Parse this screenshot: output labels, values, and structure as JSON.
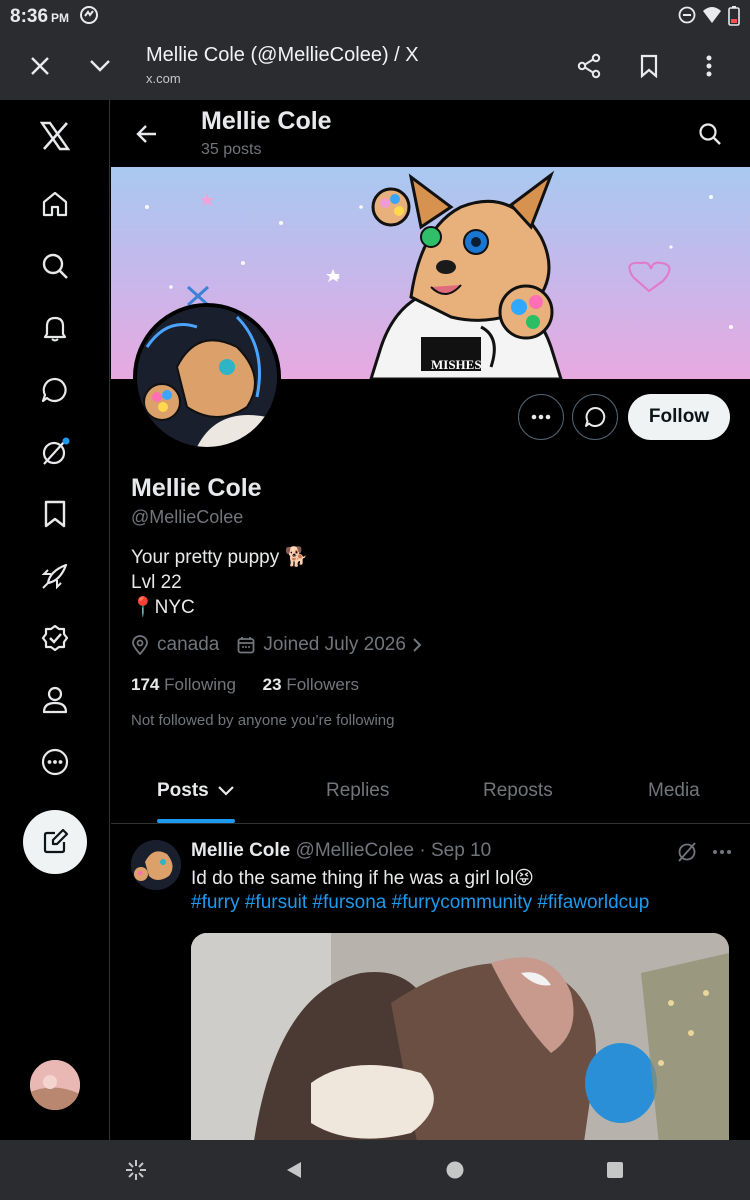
{
  "status_bar": {
    "time": "8:36",
    "ampm": "PM"
  },
  "browser": {
    "title": "Mellie Cole (@MellieColee) / X",
    "url": "x.com"
  },
  "header": {
    "name": "Mellie Cole",
    "post_count": "35 posts"
  },
  "profile": {
    "name": "Mellie Cole",
    "handle": "@MellieColee",
    "bio_lines": [
      "Your pretty puppy 🐕",
      "Lvl 22",
      "📍NYC"
    ],
    "location": "canada",
    "joined": "Joined July 2026",
    "following_count": "174",
    "following_label": "Following",
    "followers_count": "23",
    "followers_label": "Followers",
    "not_followed_text": "Not followed by anyone you’re following",
    "follow_label": "Follow"
  },
  "tabs": [
    {
      "label": "Posts",
      "active": true
    },
    {
      "label": "Replies",
      "active": false
    },
    {
      "label": "Reposts",
      "active": false
    },
    {
      "label": "Media",
      "active": false
    }
  ],
  "tweet": {
    "name": "Mellie Cole",
    "handle": "@MellieColee",
    "separator": "·",
    "date": "Sep 10",
    "text": "Id do the same thing if he was a girl lol😝",
    "hashtags": "#furry #fursuit #fursona #furrycommunity #fifaworldcup"
  },
  "banner_text": "MISHES",
  "colors": {
    "accent": "#1d9bf0",
    "background": "#000000",
    "muted": "#71767b",
    "text": "#e7e9ea",
    "chrome": "#2b2c2f"
  },
  "icons": {
    "rail": [
      "x-logo-icon",
      "home-icon",
      "search-icon",
      "bell-icon",
      "message-icon",
      "grok-icon",
      "bookmark-icon",
      "rocket-icon",
      "verified-icon",
      "profile-icon",
      "more-icon",
      "compose-icon"
    ]
  }
}
